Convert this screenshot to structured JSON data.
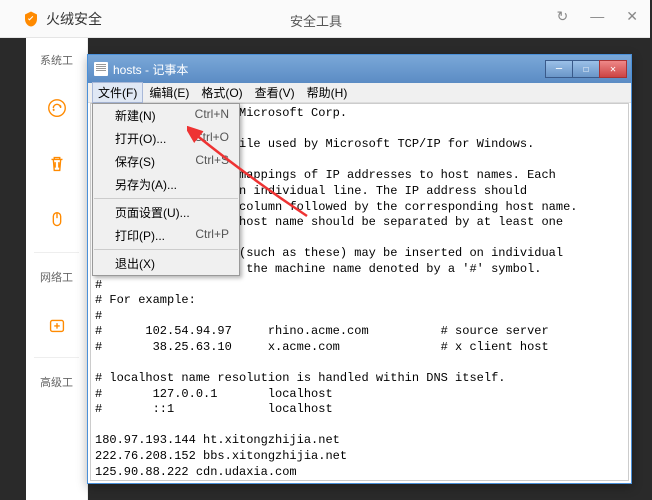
{
  "bg": {
    "brand": "火绒安全",
    "center": "安全工具",
    "sidebar": {
      "sys": "系统工",
      "net": "网络工",
      "adv": "高级工"
    }
  },
  "notepad": {
    "title": "hosts - 记事本",
    "menus": [
      "文件(F)",
      "编辑(E)",
      "格式(O)",
      "查看(V)",
      "帮助(H)"
    ],
    "file_menu": [
      {
        "label": "新建(N)",
        "shortcut": "Ctrl+N"
      },
      {
        "label": "打开(O)...",
        "shortcut": "Ctrl+O"
      },
      {
        "label": "保存(S)",
        "shortcut": "Ctrl+S"
      },
      {
        "label": "另存为(A)...",
        "shortcut": ""
      },
      {
        "sep": true
      },
      {
        "label": "页面设置(U)...",
        "shortcut": ""
      },
      {
        "label": "打印(P)...",
        "shortcut": "Ctrl+P"
      },
      {
        "sep": true
      },
      {
        "label": "退出(X)",
        "shortcut": ""
      }
    ],
    "content": "                    Microsoft Corp.\n\n                   file used by Microsoft TCP/IP for Windows.\n\n                    mappings of IP addresses to host names. Each\n                    n individual line. The IP address should\n                    column followed by the corresponding host name.\n                    host name should be separated by at least one\n\n                    (such as these) may be inserted on individual\n# lines or following the machine name denoted by a '#' symbol.\n#\n# For example:\n#\n#      102.54.94.97     rhino.acme.com          # source server\n#       38.25.63.10     x.acme.com              # x client host\n\n# localhost name resolution is handled within DNS itself.\n#\t127.0.0.1       localhost\n#\t::1             localhost\n\n180.97.193.144 ht.xitongzhijia.net\n222.76.208.152 bbs.xitongzhijia.net\n125.90.88.222 cdn.udaxia.com"
  }
}
